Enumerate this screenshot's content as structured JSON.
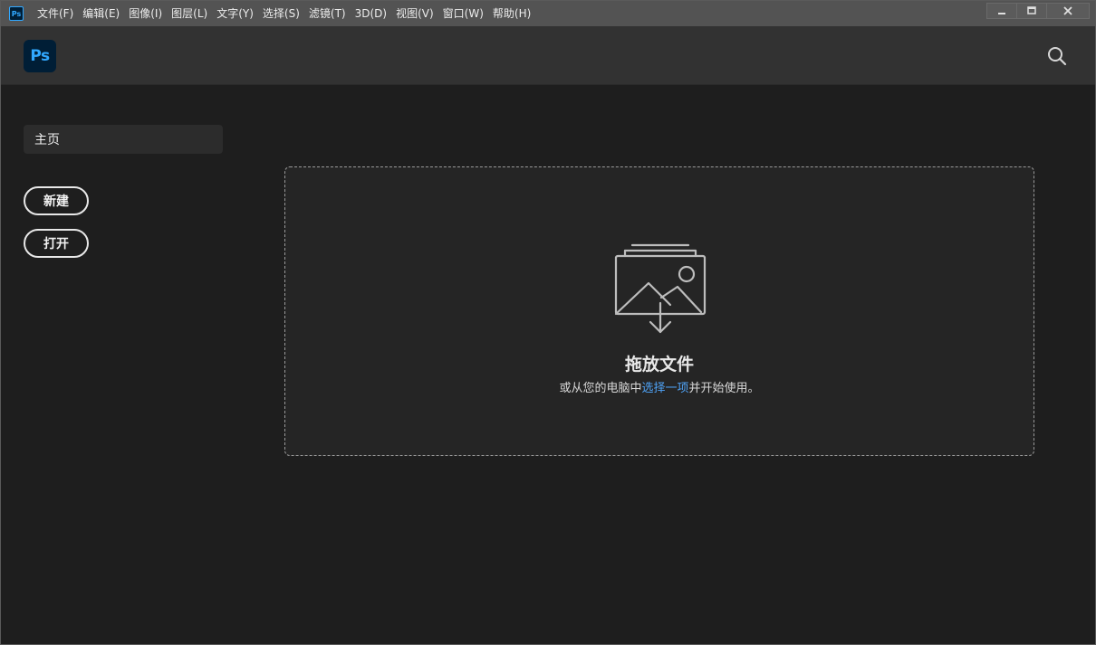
{
  "menubar": {
    "app_icon_text": "Ps",
    "items": [
      {
        "label": "文件(F)"
      },
      {
        "label": "编辑(E)"
      },
      {
        "label": "图像(I)"
      },
      {
        "label": "图层(L)"
      },
      {
        "label": "文字(Y)"
      },
      {
        "label": "选择(S)"
      },
      {
        "label": "滤镜(T)"
      },
      {
        "label": "3D(D)"
      },
      {
        "label": "视图(V)"
      },
      {
        "label": "窗口(W)"
      },
      {
        "label": "帮助(H)"
      }
    ],
    "window_controls": [
      "minimize-icon",
      "maximize-icon",
      "close-icon"
    ]
  },
  "header": {
    "logo_text": "Ps",
    "search_icon": "search-icon"
  },
  "sidebar": {
    "home_label": "主页",
    "new_label": "新建",
    "open_label": "打开"
  },
  "dropzone": {
    "icon": "image-drop-icon",
    "title": "拖放文件",
    "subtitle_before": "或从您的电脑中",
    "subtitle_link": "选择一项",
    "subtitle_after": "并开始使用。"
  },
  "colors": {
    "accent_link": "#4fa3f7",
    "ps_blue": "#31a8ff",
    "ps_dark": "#001e36",
    "background": "#1e1e1e",
    "menubar": "#535353"
  }
}
